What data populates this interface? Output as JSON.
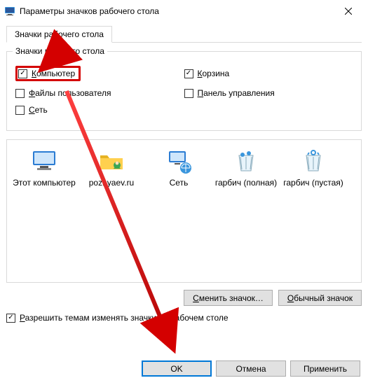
{
  "window": {
    "title": "Параметры значков рабочего стола",
    "tab_label": "Значки рабочего стола"
  },
  "group": {
    "legend": "Значки рабочего стола",
    "items": {
      "computer": {
        "label": "Компьютер",
        "checked": true
      },
      "userfiles": {
        "label": "Файлы пользователя",
        "checked": false
      },
      "network": {
        "label": "Сеть",
        "checked": false
      },
      "recyclebin": {
        "label": "Корзина",
        "checked": true
      },
      "controlpanel": {
        "label": "Панель управления",
        "checked": false
      }
    }
  },
  "preview": [
    {
      "key": "this-pc",
      "caption": "Этот компьютер",
      "icon": "monitor"
    },
    {
      "key": "user-folder",
      "caption": "poznyaev.ru",
      "icon": "folder-user"
    },
    {
      "key": "network",
      "caption": "Сеть",
      "icon": "network-monitor"
    },
    {
      "key": "bin-full",
      "caption": "гарбич (полная)",
      "icon": "bin-full"
    },
    {
      "key": "bin-empty",
      "caption": "гарбич (пустая)",
      "icon": "bin-empty"
    }
  ],
  "buttons": {
    "change_icon": "Сменить значок…",
    "default_icon": "Обычный значок"
  },
  "allow_themes": {
    "label": "Разрешить темам изменять значки на рабочем столе",
    "checked": true
  },
  "footer": {
    "ok": "OK",
    "cancel": "Отмена",
    "apply": "Применить"
  },
  "hotkey_letters": {
    "computer": "К",
    "recyclebin": "К",
    "userfiles": "Ф",
    "controlpanel": "П",
    "network": "С",
    "change_icon": "С",
    "default_icon": "О",
    "allow_themes": "Р"
  }
}
